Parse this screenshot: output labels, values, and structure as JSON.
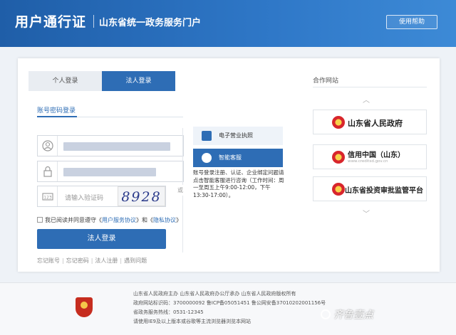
{
  "header": {
    "brand": "用户通行证",
    "subtitle": "山东省统一政务服务门户",
    "help_button": "使用帮助"
  },
  "login": {
    "tabs": [
      "个人登录",
      "法人登录"
    ],
    "active_tab": "法人登录",
    "method_title": "账号密码登录",
    "captcha_placeholder": "请输入验证码",
    "captcha_code": "8928",
    "agree_prefix": "我已阅读并同意遵守《",
    "agree_link1": "用户服务协议",
    "agree_mid": "》和《",
    "agree_link2": "隐私协议",
    "agree_suffix": "》",
    "submit": "法人登录",
    "bottom_links": [
      "忘记账号",
      "忘记密码",
      "法人注册",
      "遇到问题"
    ],
    "or_text": "或"
  },
  "side": {
    "items": [
      "电子营业执照",
      "智能客服"
    ],
    "description": "账号登录注册、认证、企业绑定问题请点击智能客服进行咨询（工作时间：周一至周五上午9:00-12:00，下午13:30-17:00）。"
  },
  "partners": {
    "title": "合作网站",
    "items": [
      {
        "name": "山东省人民政府",
        "sub": ""
      },
      {
        "name": "信用中国（山东）",
        "sub": "www.creditsd.gov.cn"
      },
      {
        "name": "山东省投资审批监管平台",
        "sub": ""
      }
    ]
  },
  "footer": {
    "lines": [
      "山东省人民政府主办  山东省人民政府办公厅承办  山东省人民政府版权所有",
      "政府网站标识码：3700000092  鲁ICP备05051451  鲁公网安备37010202001156号",
      "省政务服务热线：0531-12345",
      "请使用IE9及以上版本或谷歌等主流浏览器浏览本网站"
    ],
    "watermark": "齐鲁壹点"
  },
  "colors": {
    "primary": "#2e6db5",
    "header_start": "#1f5ea8",
    "emblem_red": "#d8262c"
  }
}
